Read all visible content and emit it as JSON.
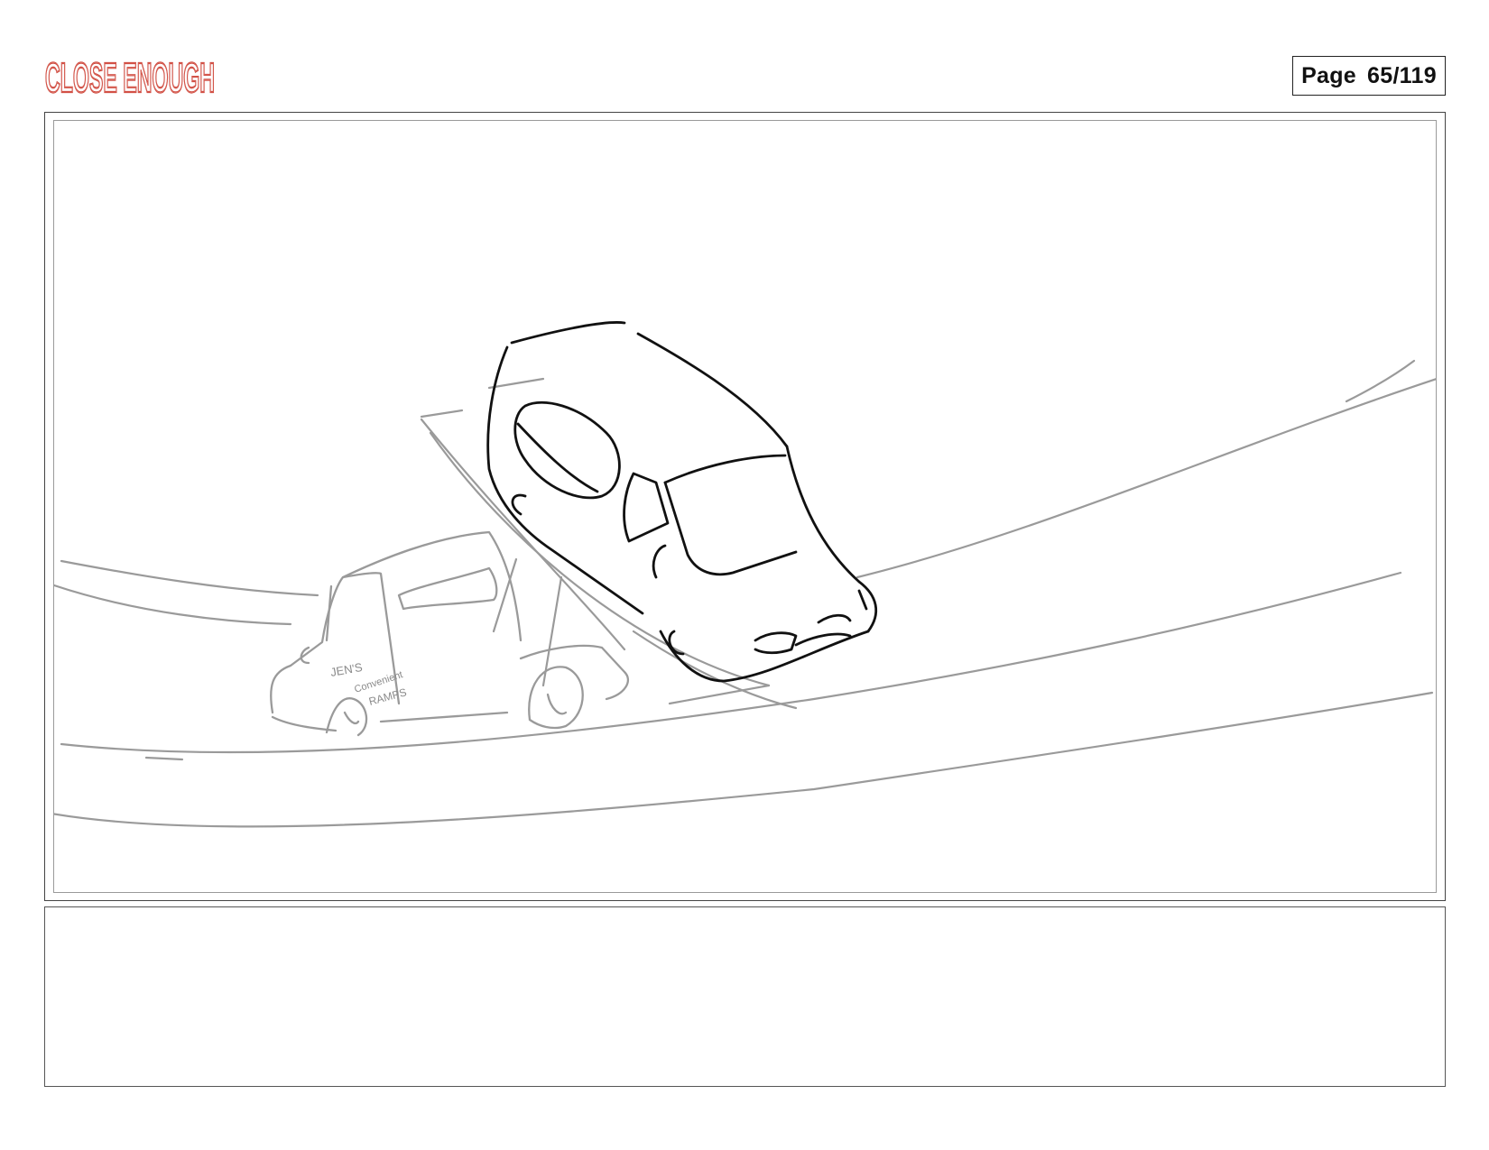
{
  "header": {
    "logo_text": "CLOSE ENOUGH",
    "page_label": "Page",
    "page_number": "65/119"
  },
  "panel": {
    "van_side_text": [
      "JEN'S",
      "Convenient",
      "RAMPS"
    ]
  },
  "notes": {
    "text": ""
  },
  "colors": {
    "logo_red": "#c8372b",
    "sketch_black": "#111111",
    "sketch_grey": "#9a9a9a"
  }
}
